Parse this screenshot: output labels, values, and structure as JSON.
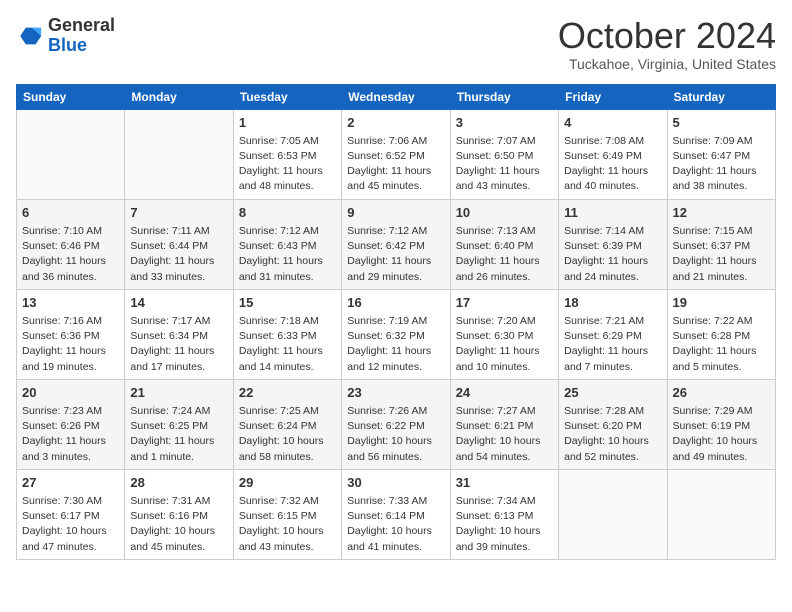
{
  "header": {
    "logo": {
      "general": "General",
      "blue": "Blue"
    },
    "title": "October 2024",
    "subtitle": "Tuckahoe, Virginia, United States"
  },
  "calendar": {
    "days_of_week": [
      "Sunday",
      "Monday",
      "Tuesday",
      "Wednesday",
      "Thursday",
      "Friday",
      "Saturday"
    ],
    "weeks": [
      [
        {
          "day": "",
          "info": ""
        },
        {
          "day": "",
          "info": ""
        },
        {
          "day": "1",
          "info": "Sunrise: 7:05 AM\nSunset: 6:53 PM\nDaylight: 11 hours and 48 minutes."
        },
        {
          "day": "2",
          "info": "Sunrise: 7:06 AM\nSunset: 6:52 PM\nDaylight: 11 hours and 45 minutes."
        },
        {
          "day": "3",
          "info": "Sunrise: 7:07 AM\nSunset: 6:50 PM\nDaylight: 11 hours and 43 minutes."
        },
        {
          "day": "4",
          "info": "Sunrise: 7:08 AM\nSunset: 6:49 PM\nDaylight: 11 hours and 40 minutes."
        },
        {
          "day": "5",
          "info": "Sunrise: 7:09 AM\nSunset: 6:47 PM\nDaylight: 11 hours and 38 minutes."
        }
      ],
      [
        {
          "day": "6",
          "info": "Sunrise: 7:10 AM\nSunset: 6:46 PM\nDaylight: 11 hours and 36 minutes."
        },
        {
          "day": "7",
          "info": "Sunrise: 7:11 AM\nSunset: 6:44 PM\nDaylight: 11 hours and 33 minutes."
        },
        {
          "day": "8",
          "info": "Sunrise: 7:12 AM\nSunset: 6:43 PM\nDaylight: 11 hours and 31 minutes."
        },
        {
          "day": "9",
          "info": "Sunrise: 7:12 AM\nSunset: 6:42 PM\nDaylight: 11 hours and 29 minutes."
        },
        {
          "day": "10",
          "info": "Sunrise: 7:13 AM\nSunset: 6:40 PM\nDaylight: 11 hours and 26 minutes."
        },
        {
          "day": "11",
          "info": "Sunrise: 7:14 AM\nSunset: 6:39 PM\nDaylight: 11 hours and 24 minutes."
        },
        {
          "day": "12",
          "info": "Sunrise: 7:15 AM\nSunset: 6:37 PM\nDaylight: 11 hours and 21 minutes."
        }
      ],
      [
        {
          "day": "13",
          "info": "Sunrise: 7:16 AM\nSunset: 6:36 PM\nDaylight: 11 hours and 19 minutes."
        },
        {
          "day": "14",
          "info": "Sunrise: 7:17 AM\nSunset: 6:34 PM\nDaylight: 11 hours and 17 minutes."
        },
        {
          "day": "15",
          "info": "Sunrise: 7:18 AM\nSunset: 6:33 PM\nDaylight: 11 hours and 14 minutes."
        },
        {
          "day": "16",
          "info": "Sunrise: 7:19 AM\nSunset: 6:32 PM\nDaylight: 11 hours and 12 minutes."
        },
        {
          "day": "17",
          "info": "Sunrise: 7:20 AM\nSunset: 6:30 PM\nDaylight: 11 hours and 10 minutes."
        },
        {
          "day": "18",
          "info": "Sunrise: 7:21 AM\nSunset: 6:29 PM\nDaylight: 11 hours and 7 minutes."
        },
        {
          "day": "19",
          "info": "Sunrise: 7:22 AM\nSunset: 6:28 PM\nDaylight: 11 hours and 5 minutes."
        }
      ],
      [
        {
          "day": "20",
          "info": "Sunrise: 7:23 AM\nSunset: 6:26 PM\nDaylight: 11 hours and 3 minutes."
        },
        {
          "day": "21",
          "info": "Sunrise: 7:24 AM\nSunset: 6:25 PM\nDaylight: 11 hours and 1 minute."
        },
        {
          "day": "22",
          "info": "Sunrise: 7:25 AM\nSunset: 6:24 PM\nDaylight: 10 hours and 58 minutes."
        },
        {
          "day": "23",
          "info": "Sunrise: 7:26 AM\nSunset: 6:22 PM\nDaylight: 10 hours and 56 minutes."
        },
        {
          "day": "24",
          "info": "Sunrise: 7:27 AM\nSunset: 6:21 PM\nDaylight: 10 hours and 54 minutes."
        },
        {
          "day": "25",
          "info": "Sunrise: 7:28 AM\nSunset: 6:20 PM\nDaylight: 10 hours and 52 minutes."
        },
        {
          "day": "26",
          "info": "Sunrise: 7:29 AM\nSunset: 6:19 PM\nDaylight: 10 hours and 49 minutes."
        }
      ],
      [
        {
          "day": "27",
          "info": "Sunrise: 7:30 AM\nSunset: 6:17 PM\nDaylight: 10 hours and 47 minutes."
        },
        {
          "day": "28",
          "info": "Sunrise: 7:31 AM\nSunset: 6:16 PM\nDaylight: 10 hours and 45 minutes."
        },
        {
          "day": "29",
          "info": "Sunrise: 7:32 AM\nSunset: 6:15 PM\nDaylight: 10 hours and 43 minutes."
        },
        {
          "day": "30",
          "info": "Sunrise: 7:33 AM\nSunset: 6:14 PM\nDaylight: 10 hours and 41 minutes."
        },
        {
          "day": "31",
          "info": "Sunrise: 7:34 AM\nSunset: 6:13 PM\nDaylight: 10 hours and 39 minutes."
        },
        {
          "day": "",
          "info": ""
        },
        {
          "day": "",
          "info": ""
        }
      ]
    ]
  }
}
